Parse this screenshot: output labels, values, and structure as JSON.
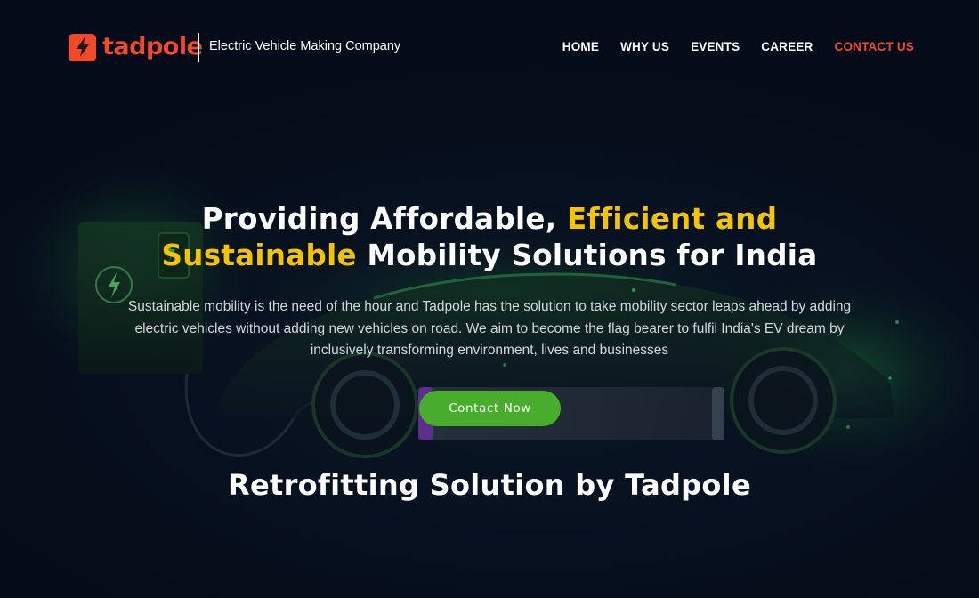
{
  "header": {
    "logo": {
      "icon": "lightning-bolt-icon",
      "wordmark": "tadpole"
    },
    "tagline": "Electric Vehicle Making Company",
    "nav": [
      {
        "label": "HOME",
        "active": false
      },
      {
        "label": "WHY US",
        "active": false
      },
      {
        "label": "EVENTS",
        "active": false
      },
      {
        "label": "CAREER",
        "active": false
      },
      {
        "label": "CONTACT US",
        "active": true
      }
    ]
  },
  "hero": {
    "title_part1": "Providing Affordable, ",
    "title_highlight": "Efficient and Sustainable",
    "title_part2": " Mobility Solutions for India",
    "description": "Sustainable mobility is the need of the hour and Tadpole has the solution to take mobility sector leaps ahead by adding electric vehicles without adding new vehicles on road. We aim to become the flag bearer to fulfil India's EV dream by inclusively transforming environment, lives and businesses",
    "cta_label": "Contact Now"
  },
  "section": {
    "title": "Retrofitting Solution by Tadpole"
  },
  "colors": {
    "brand": "#f04a2a",
    "highlight": "#f5c400",
    "cta": "#49ad2c",
    "background": "#060d1c"
  }
}
